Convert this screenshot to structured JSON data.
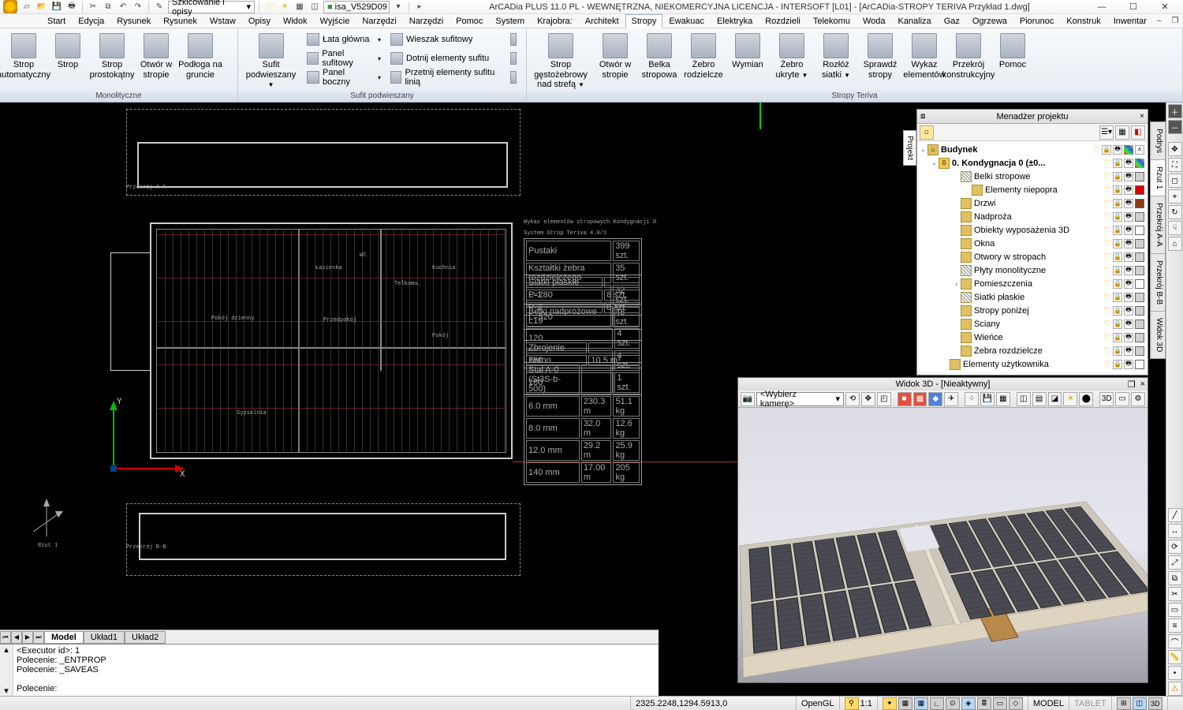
{
  "app": {
    "title": "ArCADia PLUS 11.0 PL - WEWNĘTRZNA, NIEKOMERCYJNA LICENCJA - INTERSOFT [L01] - [ArCADia-STROPY TERIVA Przykład 1.dwg]",
    "layer_combo_name": "isa_V529D09",
    "sketch_combo": "Szkicowanie i opisy"
  },
  "menus": [
    "Start",
    "Edycja",
    "Rysunek",
    "Rysunek",
    "Wstaw",
    "Opisy",
    "Widok",
    "Wyjście",
    "Narzędzi",
    "Narzędzi",
    "Pomoc",
    "System",
    "Krajobra:",
    "Architekt",
    "Stropy",
    "Ewakuac",
    "Elektryka",
    "Rozdzieli",
    "Telekomu",
    "Woda",
    "Kanaliza",
    "Gaz",
    "Ogrzewa",
    "Piorunoc",
    "Konstruk",
    "Inwentar"
  ],
  "active_menu": "Stropy",
  "ribbon": {
    "groups": [
      {
        "title": "Monolityczne",
        "items": [
          {
            "label": "Strop automatyczny"
          },
          {
            "label": "Strop"
          },
          {
            "label": "Strop prostokątny"
          },
          {
            "label": "Otwór w stropie"
          },
          {
            "label": "Podłoga na gruncie"
          }
        ]
      },
      {
        "title": "Sufit podwieszany",
        "big": [
          {
            "label": "Sufit podwieszany",
            "dd": true
          }
        ],
        "rows": [
          {
            "label": "Łata główna",
            "dd": true
          },
          {
            "label": "Panel sufitowy",
            "dd": true
          },
          {
            "label": "Panel boczny",
            "dd": true
          }
        ],
        "rows2": [
          {
            "label": "Wieszak sufitowy"
          },
          {
            "label": "Dotnij elementy sufitu"
          },
          {
            "label": "Przetnij elementy sufitu linią"
          }
        ],
        "rows3": [
          {
            "icon": true
          },
          {
            "icon": true
          },
          {
            "icon": true
          }
        ]
      },
      {
        "title": "Stropy Teriva",
        "items": [
          {
            "label": "Strop gęstożebrowy nad strefą",
            "dd": true,
            "wide": true
          },
          {
            "label": "Otwór w stropie"
          },
          {
            "label": "Belka stropowa"
          },
          {
            "label": "Żebro rodzielcze"
          },
          {
            "label": "Wymian"
          },
          {
            "label": "Żebro ukryte",
            "dd": true
          },
          {
            "label": "Rozłóż siatki",
            "dd": true
          },
          {
            "label": "Sprawdź stropy"
          },
          {
            "label": "Wykaz elementów"
          },
          {
            "label": "Przekrój konstrukcyjny"
          },
          {
            "label": "Pomoc"
          }
        ]
      }
    ]
  },
  "layout_tabs": [
    "Model",
    "Układ1",
    "Układ2"
  ],
  "active_layout": "Model",
  "cmd": {
    "lines": "<Executor id>: 1\nPolecenie: _ENTPROP\nPolecenie: _SAVEAS\n\nPolecenie:"
  },
  "status": {
    "coords": "2325.2248,1294.5913,0",
    "renderer": "OpenGL",
    "scale": "1:1",
    "model": "MODEL",
    "tablet": "TABLET"
  },
  "pm": {
    "title": "Menadżer projektu",
    "vtab": "Projekt",
    "root": "Budynek",
    "level": "0. Kondygnacja 0 (±0...",
    "items": [
      {
        "label": "Belki stropowe",
        "icon": "hatch",
        "swatch": "#d0d0d0",
        "indent": 2
      },
      {
        "label": "Elementy niepopra",
        "icon": "warn",
        "swatch": "#d80000",
        "indent": 3
      },
      {
        "label": "Drzwi",
        "icon": "door",
        "swatch": "#8a3a1a",
        "indent": 2
      },
      {
        "label": "Nadproża",
        "icon": "beam",
        "swatch": "#d0d0d0",
        "indent": 2
      },
      {
        "label": "Obiekty wyposażenia 3D",
        "icon": "obj",
        "swatch": "#ffffff",
        "indent": 2
      },
      {
        "label": "Okna",
        "icon": "win",
        "swatch": "#d0d0d0",
        "indent": 2
      },
      {
        "label": "Otwory w stropach",
        "icon": "hole",
        "swatch": "#d0d0d0",
        "indent": 2
      },
      {
        "label": "Płyty monolityczne",
        "icon": "hatch",
        "swatch": "#d0d0d0",
        "indent": 2
      },
      {
        "label": "Pomieszczenia",
        "icon": "room",
        "swatch": "#ffffff",
        "indent": 2,
        "expander": true
      },
      {
        "label": "Siatki płaskie",
        "icon": "hatch",
        "swatch": "#d0d0d0",
        "indent": 2
      },
      {
        "label": "Stropy poniżej",
        "icon": "slab",
        "swatch": "#d0d0d0",
        "indent": 2
      },
      {
        "label": "Ściany",
        "icon": "wall",
        "swatch": "#d0d0d0",
        "indent": 2
      },
      {
        "label": "Wieńce",
        "icon": "ring",
        "swatch": "#d0d0d0",
        "indent": 2
      },
      {
        "label": "Żebra rozdzielcze",
        "icon": "rib",
        "swatch": "#d0d0d0",
        "indent": 2
      },
      {
        "label": "Elementy użytkownika",
        "icon": "user",
        "swatch": "#ffffff",
        "indent": 1
      }
    ]
  },
  "side_tabs": [
    "Podrys",
    "Rzut 1",
    "Przekrój A-A",
    "Przekrój B-B",
    "Widok 3D"
  ],
  "active_side_tab": "Rzut 1",
  "view3d": {
    "title": "Widok 3D - [Nieaktywny]",
    "camera": "<Wybierz kamerę>"
  },
  "plan": {
    "section_a": "Przekrój A-A",
    "section_b": "Przekrój B-B",
    "view_label": "Rzut 1",
    "rooms": [
      "Kuchnia",
      "Łazienka",
      "WC",
      "Kuchnia",
      "Pokój dzienny",
      "Przedpokój",
      "Pokój",
      "Sypialnia",
      "Telkomu."
    ],
    "sched_title": "Wykaz elementów stropowych Kondygnacji 0",
    "sched_sys": "System Strop Teriva 4.0/1",
    "tables": [
      [
        [
          "Pustaki",
          "399 szt."
        ],
        [
          "Kształtki żebra rozdzielczego",
          "35 szt."
        ],
        [
          "L=280",
          "32 szt."
        ],
        [
          "L=520",
          "48 szt."
        ]
      ],
      [
        [
          "Siatki płaskie",
          ""
        ],
        [
          "P-1",
          "8 szt."
        ],
        [
          "P-2",
          "8 szt."
        ]
      ],
      [
        [
          "Belki nadprożowe L19",
          ""
        ],
        [
          "120",
          "4 szt."
        ],
        [
          "150",
          "4 szt."
        ],
        [
          "180",
          "1 szt."
        ]
      ],
      [
        [
          "Zbrojenie",
          ""
        ],
        [
          "Beton",
          "10.5 m³"
        ]
      ],
      [
        [
          "Stal A-0 (St3S-b-500)",
          "",
          ""
        ],
        [
          "6.0 mm",
          "230.3 m",
          "51.1 kg"
        ],
        [
          "8.0 mm",
          "32.0 m",
          "12.6 kg"
        ],
        [
          "12.0 mm",
          "29.2 m",
          "25.9 kg"
        ],
        [
          "140 mm",
          "17.00 m",
          "205 kg"
        ]
      ]
    ]
  }
}
